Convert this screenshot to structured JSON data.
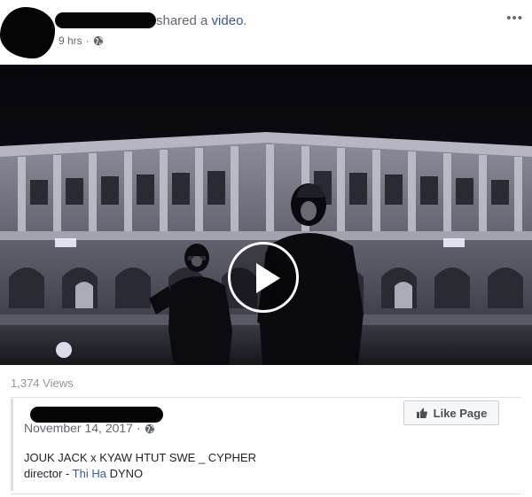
{
  "post": {
    "action_text": "shared a",
    "object_link": "video",
    "object_suffix": ".",
    "time": "9 hrs",
    "time_separator": "·",
    "privacy_icon": "globe-icon",
    "more_label": "•••"
  },
  "video": {
    "play_icon": "play-icon",
    "views": "1,374 Views"
  },
  "shared_page": {
    "date": "November 14, 2017",
    "date_separator": "·",
    "privacy_icon": "globe-icon",
    "like_button_label": "Like Page",
    "like_icon": "thumbs-up-icon",
    "caption_line1": "JOUK JACK x KYAW HTUT SWE _ CYPHER",
    "caption_director_prefix": "director - ",
    "caption_director_name": "Thi Ha",
    "caption_director_suffix": " DYNO"
  },
  "colors": {
    "link": "#385898",
    "meta_text": "#616770",
    "divider": "#dddfe2"
  }
}
